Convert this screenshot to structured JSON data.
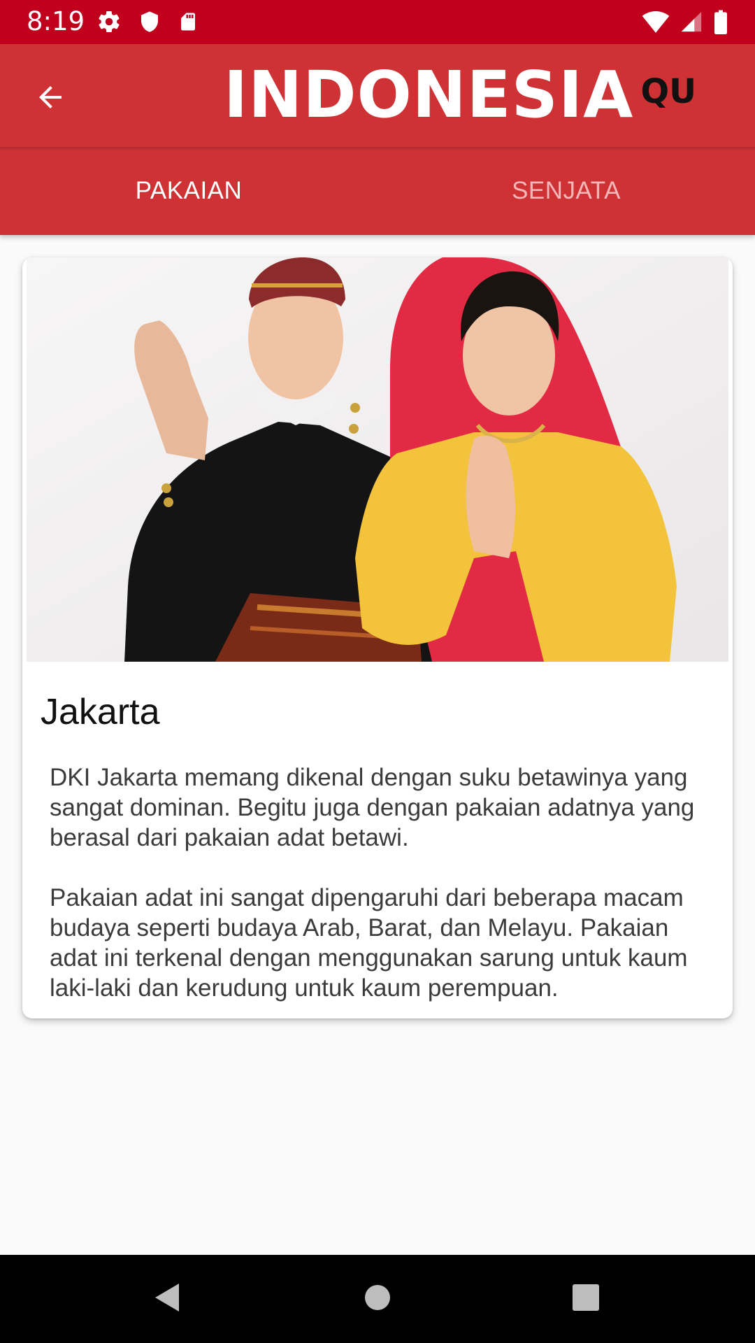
{
  "status_bar": {
    "time": "8:19",
    "left_icons": [
      "settings-icon",
      "shield-icon",
      "sd-card-icon"
    ],
    "right_icons": [
      "wifi-icon",
      "signal-icon",
      "battery-icon"
    ]
  },
  "app_bar": {
    "logo_main": "INDONESIA",
    "logo_sub": "QU"
  },
  "tabs": [
    {
      "label": "PAKAIAN",
      "active": true
    },
    {
      "label": "SENJATA",
      "active": false
    }
  ],
  "card": {
    "title": "Jakarta",
    "description": "DKI Jakarta memang dikenal dengan suku betawinya yang sangat dominan. Begitu juga dengan pakaian adatnya yang berasal dari pakaian adat betawi.\n\nPakaian adat ini sangat dipengaruhi dari beberapa macam budaya seperti budaya Arab, Barat, dan Melayu. Pakaian adat ini terkenal dengan menggunakan sarung untuk kaum laki-laki dan kerudung untuk kaum perempuan."
  },
  "colors": {
    "status_bar": "#c0001c",
    "app_bar": "#cf3235",
    "tab_active": "#ffffff",
    "tab_inactive": "#f4b6b6"
  }
}
